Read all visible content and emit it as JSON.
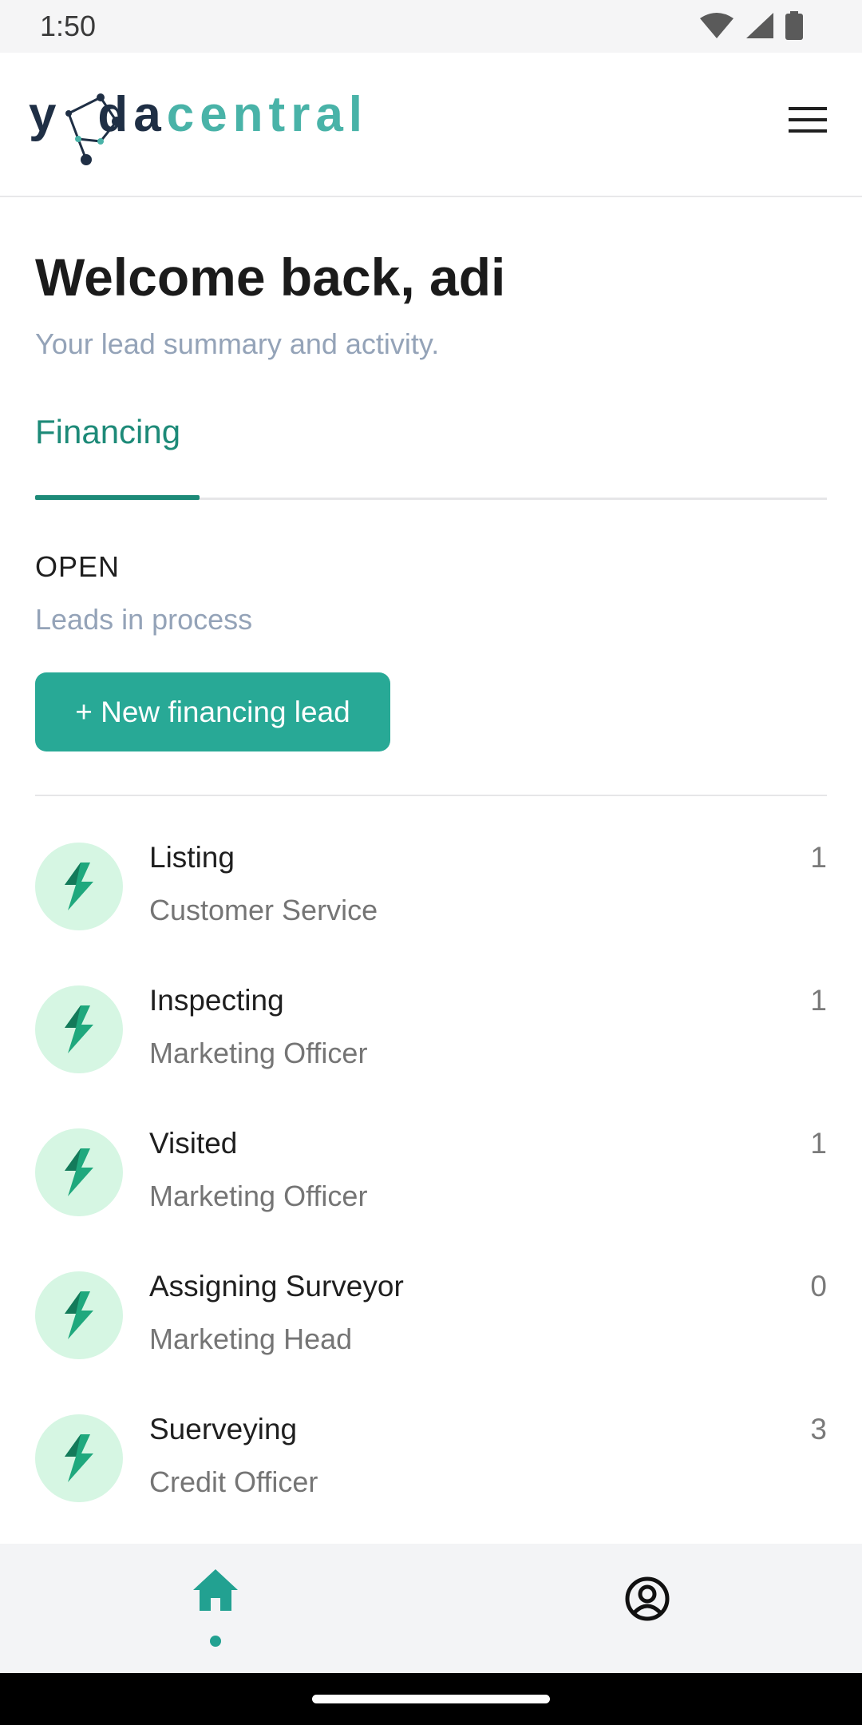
{
  "status_bar": {
    "time": "1:50",
    "icons": [
      "wifi-icon",
      "signal-icon",
      "battery-icon"
    ]
  },
  "header": {
    "logo": {
      "part1": "y",
      "part2": "o",
      "part3": "da",
      "part4": "central"
    },
    "menu_icon": "hamburger-menu-icon"
  },
  "main": {
    "title": "Welcome back, adi",
    "subtitle": "Your lead summary and activity.",
    "tabs": [
      {
        "label": "Financing",
        "active": true
      }
    ],
    "section": {
      "title": "OPEN",
      "subtitle": "Leads in process"
    },
    "new_lead_button": "+ New financing lead",
    "items": [
      {
        "title": "Listing",
        "subtitle": "Customer Service",
        "count": "1",
        "icon": "lightning-bolt-icon"
      },
      {
        "title": "Inspecting",
        "subtitle": "Marketing Officer",
        "count": "1",
        "icon": "lightning-bolt-icon"
      },
      {
        "title": "Visited",
        "subtitle": "Marketing Officer",
        "count": "1",
        "icon": "lightning-bolt-icon"
      },
      {
        "title": "Assigning Surveyor",
        "subtitle": "Marketing Head",
        "count": "0",
        "icon": "lightning-bolt-icon"
      },
      {
        "title": "Suerveying",
        "subtitle": "Credit Officer",
        "count": "3",
        "icon": "lightning-bolt-icon"
      }
    ]
  },
  "bottom_nav": {
    "items": [
      {
        "icon": "home-icon",
        "active": true
      },
      {
        "icon": "profile-icon",
        "active": false
      }
    ]
  },
  "colors": {
    "accent": "#28a996",
    "tab_active": "#1d8a78",
    "avatar_bg": "#d6f6e3",
    "subtle_text": "#94a3b8"
  }
}
